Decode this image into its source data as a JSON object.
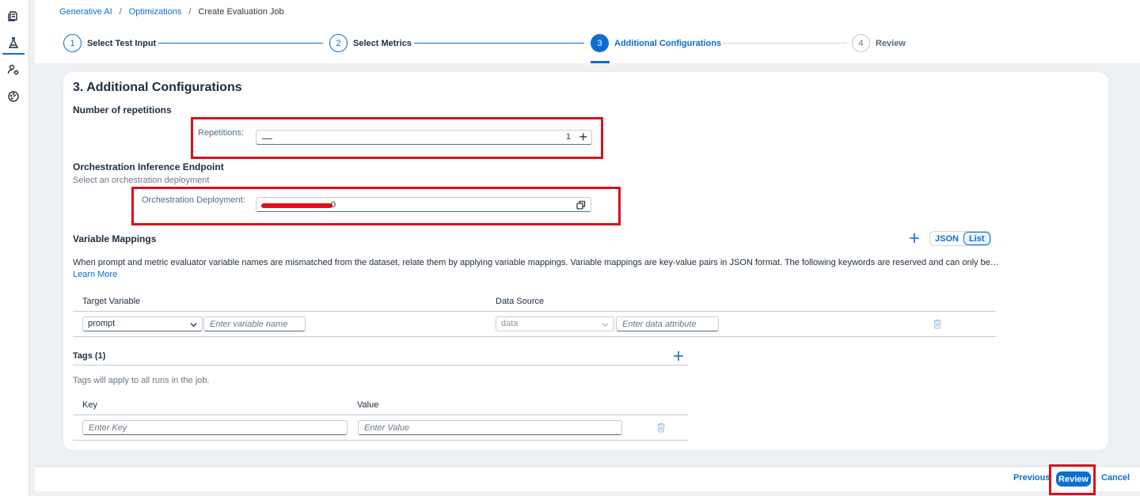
{
  "breadcrumb": {
    "items": [
      "Generative AI",
      "Optimizations"
    ],
    "separator": "/",
    "current": "Create Evaluation Job"
  },
  "wizard": {
    "steps": [
      {
        "number": "1",
        "label": "Select Test Input",
        "state": "completed"
      },
      {
        "number": "2",
        "label": "Select Metrics",
        "state": "completed"
      },
      {
        "number": "3",
        "label": "Additional Configurations",
        "state": "current"
      },
      {
        "number": "4",
        "label": "Review",
        "state": "future"
      }
    ]
  },
  "section": {
    "title": "3. Additional Configurations",
    "repetitions": {
      "heading": "Number of repetitions",
      "label": "Repetitions:",
      "value": "1",
      "minus": "—",
      "plus": "+"
    },
    "orchestration": {
      "heading": "Orchestration Inference Endpoint",
      "hint": "Select an orchestration deployment",
      "label": "Orchestration Deployment:",
      "value_suffix": "0"
    },
    "variable_mappings": {
      "heading": "Variable Mappings",
      "description": "When prompt and metric evaluator variable names are mismatched from the dataset, relate them by applying variable mappings. Variable mappings are key-value pairs in JSON format. The following keywords are reserved and can only be used as...",
      "learn_more": "Learn More",
      "view_toggle": [
        "JSON",
        "List"
      ],
      "columns": [
        "Target Variable",
        "Data Source"
      ],
      "row": {
        "target_select": "prompt",
        "variable_placeholder": "Enter variable name",
        "source_select": "data",
        "attribute_placeholder": "Enter data attribute"
      }
    },
    "tags": {
      "heading": "Tags (1)",
      "hint": "Tags will apply to all runs in the job.",
      "columns": [
        "Key",
        "Value"
      ],
      "key_placeholder": "Enter Key",
      "value_placeholder": "Enter Value"
    }
  },
  "footer": {
    "previous": "Previous",
    "review": "Review",
    "cancel": "Cancel"
  },
  "colors": {
    "accent": "#0a6ed1",
    "highlight": "#d9101c"
  }
}
